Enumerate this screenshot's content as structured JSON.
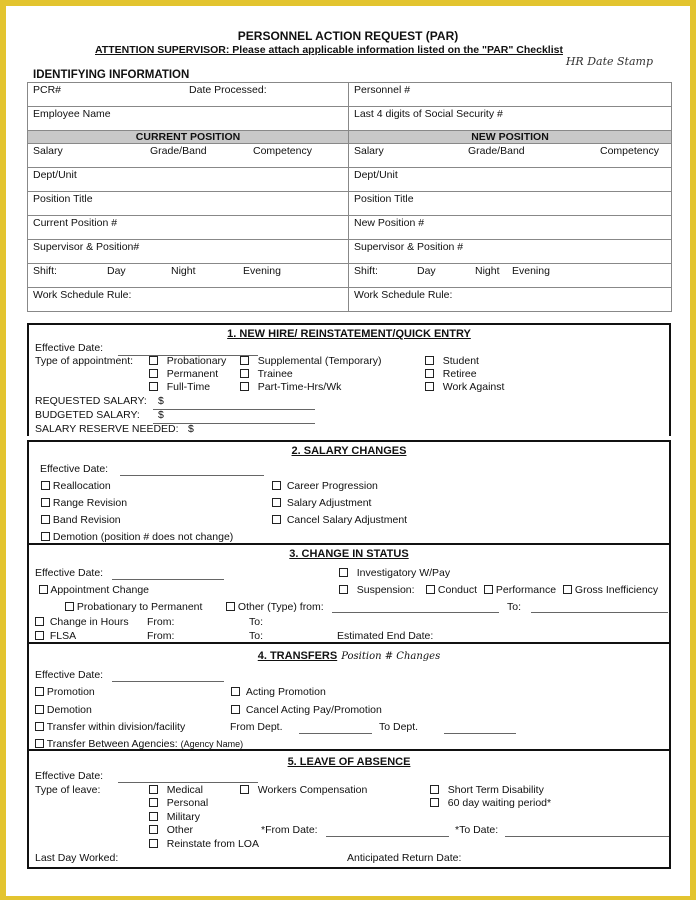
{
  "header": {
    "title": "PERSONNEL ACTION REQUEST (PAR)",
    "subtitle": "ATTENTION  SUPERVISOR:  Please attach applicable information listed on the \"PAR\" Checklist",
    "hr_stamp": "HR Date Stamp",
    "section_label": "IDENTIFYING INFORMATION"
  },
  "identifying": {
    "pcr": "PCR#",
    "date_processed": "Date Processed:",
    "personnel": "Personnel #",
    "employee_name": "Employee Name",
    "ssn": "Last 4 digits of Social Security #",
    "current_header": "CURRENT POSITION",
    "new_header": "NEW POSITION",
    "current": {
      "salary": "Salary",
      "grade": "Grade/Band",
      "competency": "Competency",
      "dept": "Dept/Unit",
      "title": "Position Title",
      "position": "Current Position #",
      "supervisor": "Supervisor & Position#",
      "shift": "Shift:",
      "day": "Day",
      "night": "Night",
      "evening": "Evening",
      "schedule": "Work Schedule Rule:"
    },
    "new": {
      "salary": "Salary",
      "grade": "Grade/Band",
      "competency": "Competency",
      "dept": "Dept/Unit",
      "title": "Position Title",
      "position": "New Position #",
      "supervisor": "Supervisor & Position #",
      "shift": "Shift:",
      "day": "Day",
      "night": "Night",
      "evening": "Evening",
      "schedule": "Work Schedule Rule:"
    }
  },
  "s1": {
    "title": "1.  NEW HIRE/ REINSTATEMENT/QUICK ENTRY",
    "effective_date": "Effective Date:",
    "type_label": "Type of appointment:",
    "options": [
      "Probationary",
      "Permanent",
      "Full-Time",
      "Supplemental (Temporary)",
      "Trainee",
      "Part-Time-Hrs/Wk",
      "Student",
      "Retiree",
      "Work Against"
    ],
    "requested": "REQUESTED SALARY:",
    "budgeted": "BUDGETED SALARY:",
    "reserve": "SALARY RESERVE NEEDED:",
    "dollar": "$"
  },
  "s2": {
    "title": "2.  SALARY CHANGES",
    "effective_date": "Effective Date:",
    "options": [
      "Reallocation",
      "Range Revision",
      "Band Revision",
      "Demotion (position # does not change)",
      "Career Progression",
      "Salary Adjustment",
      "Cancel Salary Adjustment"
    ]
  },
  "s3": {
    "title": "3.  CHANGE IN STATUS",
    "effective_date": "Effective Date:",
    "investigatory": "Investigatory W/Pay",
    "appointment_change": "Appointment Change",
    "suspension": "Suspension:",
    "conduct": "Conduct",
    "performance": "Performance",
    "gross": "Gross Inefficiency",
    "prob_perm": "Probationary to Permanent",
    "other": "Other (Type) from:",
    "to": "To:",
    "hours": "Change in Hours",
    "flsa": "FLSA",
    "from": "From:",
    "est_end": "Estimated End Date:"
  },
  "s4": {
    "title": "4.  TRANSFERS",
    "title_note": "Position # Changes",
    "effective_date": "Effective Date:",
    "promotion": "Promotion",
    "acting": "Acting Promotion",
    "demotion": "Demotion",
    "cancel_acting": "Cancel Acting Pay/Promotion",
    "within": "Transfer within division/facility",
    "from_dept": "From Dept.",
    "to_dept": "To Dept.",
    "between": "Transfer Between Agencies:",
    "agency": "(Agency Name)"
  },
  "s5": {
    "title": "5.  LEAVE OF ABSENCE",
    "effective_date": "Effective Date:",
    "type_label": "Type of leave:",
    "medical": "Medical",
    "personal": "Personal",
    "military": "Military",
    "other": "Other",
    "reinstate": "Reinstate from LOA",
    "workers": "Workers Compensation",
    "std": "Short Term Disability",
    "waiting": "60 day waiting period*",
    "from_date": "*From Date:",
    "to_date": "*To Date:",
    "last_day": "Last Day Worked:",
    "return": "Anticipated Return Date:"
  }
}
